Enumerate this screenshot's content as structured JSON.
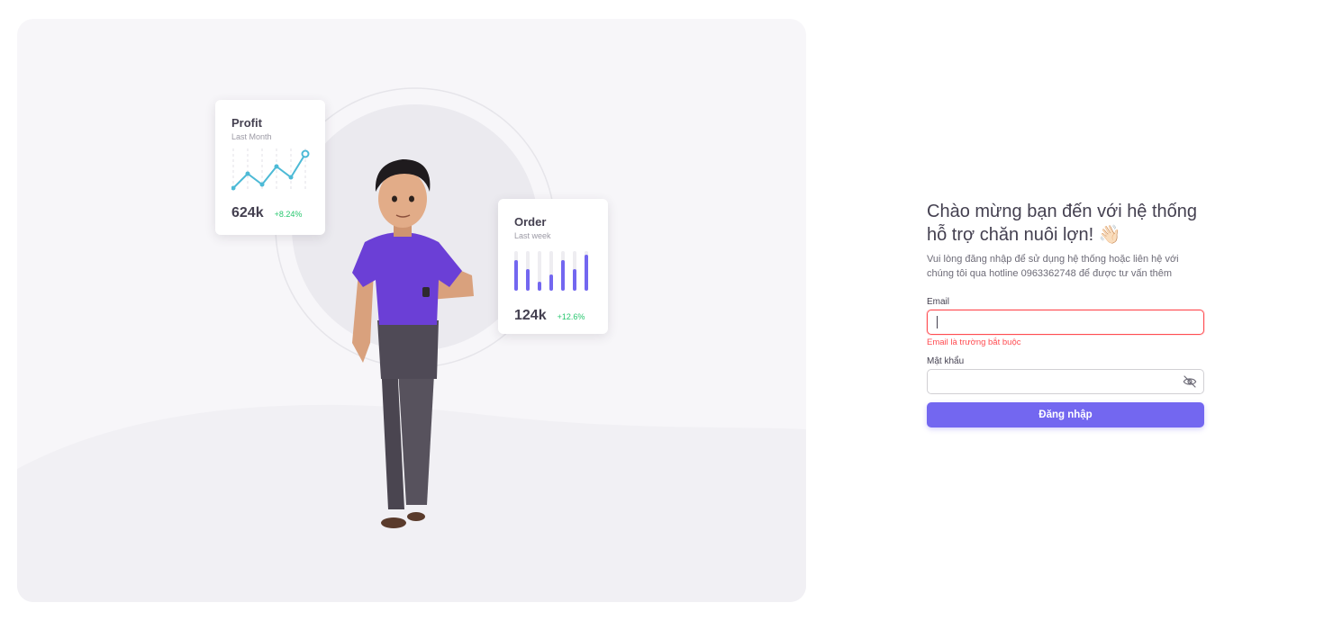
{
  "cards": {
    "profit": {
      "title": "Profit",
      "subtitle": "Last Month",
      "value": "624k",
      "delta": "+8.24%"
    },
    "order": {
      "title": "Order",
      "subtitle": "Last week",
      "value": "124k",
      "delta": "+12.6%"
    }
  },
  "login": {
    "title_line1": "Chào mừng bạn đến với hệ thống",
    "title_line2": "hỗ trợ chăn nuôi lợn! 👋🏻",
    "subtitle": "Vui lòng đăng nhập để sử dụng hệ thống hoặc liên hệ với chúng tôi qua hotline 0963362748 để được tư vấn thêm",
    "email_label": "Email",
    "email_value": "",
    "email_error": "Email là trường bắt buộc",
    "password_label": "Mật khẩu",
    "password_value": "",
    "submit_label": "Đăng nhập"
  },
  "icons": {
    "password_toggle": "eye-off-icon",
    "wave": "waving-hand-emoji"
  },
  "colors": {
    "primary": "#7367f0",
    "error": "#ff4c51",
    "success": "#28c76f",
    "panel_bg": "#f7f6f9"
  }
}
